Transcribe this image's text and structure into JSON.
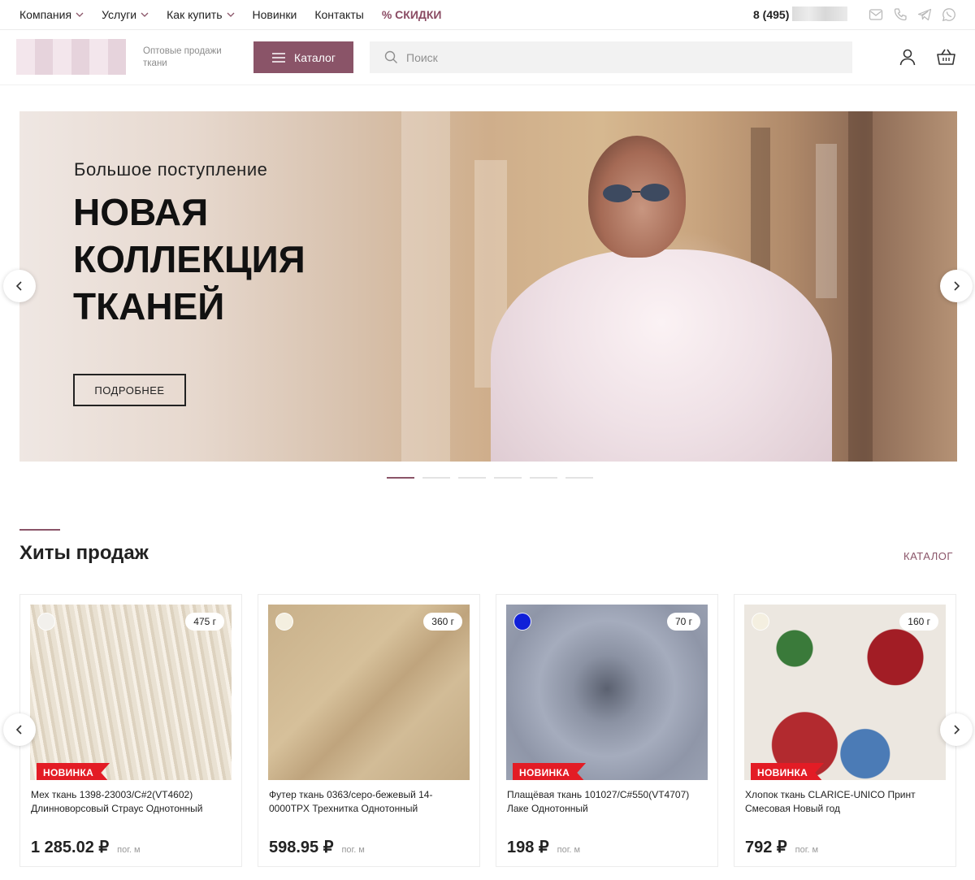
{
  "topnav": {
    "items": [
      {
        "label": "Компания",
        "has_dropdown": true
      },
      {
        "label": "Услуги",
        "has_dropdown": true
      },
      {
        "label": "Как купить",
        "has_dropdown": true
      },
      {
        "label": "Новинки",
        "has_dropdown": false
      },
      {
        "label": "Контакты",
        "has_dropdown": false
      }
    ],
    "sale_label": "% СКИДКИ",
    "phone_prefix": "8 (495)",
    "socials": [
      "mail-icon",
      "phone-icon",
      "telegram-icon",
      "whatsapp-icon"
    ]
  },
  "header": {
    "tagline": "Оптовые продажи ткани",
    "catalog_label": "Каталог",
    "search_placeholder": "Поиск"
  },
  "banner": {
    "subtitle": "Большое поступление",
    "title": "НОВАЯ КОЛЛЕКЦИЯ ТКАНЕЙ",
    "button_label": "ПОДРОБНЕЕ",
    "slides_count": 6,
    "active_slide": 1
  },
  "section": {
    "title": "Хиты продаж",
    "link_label": "КАТАЛОГ"
  },
  "products": [
    {
      "name": "Мех ткань 1398-23003/C#2(VT4602) Длинноворсовый Страус Однотонный",
      "price": "1 285.02 ₽",
      "unit": "пог. м",
      "weight": "475 г",
      "badge": "НОВИНКА",
      "swatch_color": "#f2f0ec"
    },
    {
      "name": "Футер ткань 0363/серо-бежевый 14-0000TPX Трехнитка Однотонный",
      "price": "598.95 ₽",
      "unit": "пог. м",
      "weight": "360 г",
      "badge": "",
      "swatch_color": "#f4efe0"
    },
    {
      "name": "Плащёвая ткань 101027/C#550(VT4707) Лаке Однотонный",
      "price": "198 ₽",
      "unit": "пог. м",
      "weight": "70 г",
      "badge": "НОВИНКА",
      "swatch_color": "#1020d8"
    },
    {
      "name": "Хлопок ткань CLARICE-UNICO Принт Смесовая Новый год",
      "price": "792 ₽",
      "unit": "пог. м",
      "weight": "160 г",
      "badge": "НОВИНКА",
      "swatch_color": "#f4efe0"
    }
  ],
  "colors": {
    "accent": "#8a5468",
    "badge_red": "#e31c25"
  }
}
